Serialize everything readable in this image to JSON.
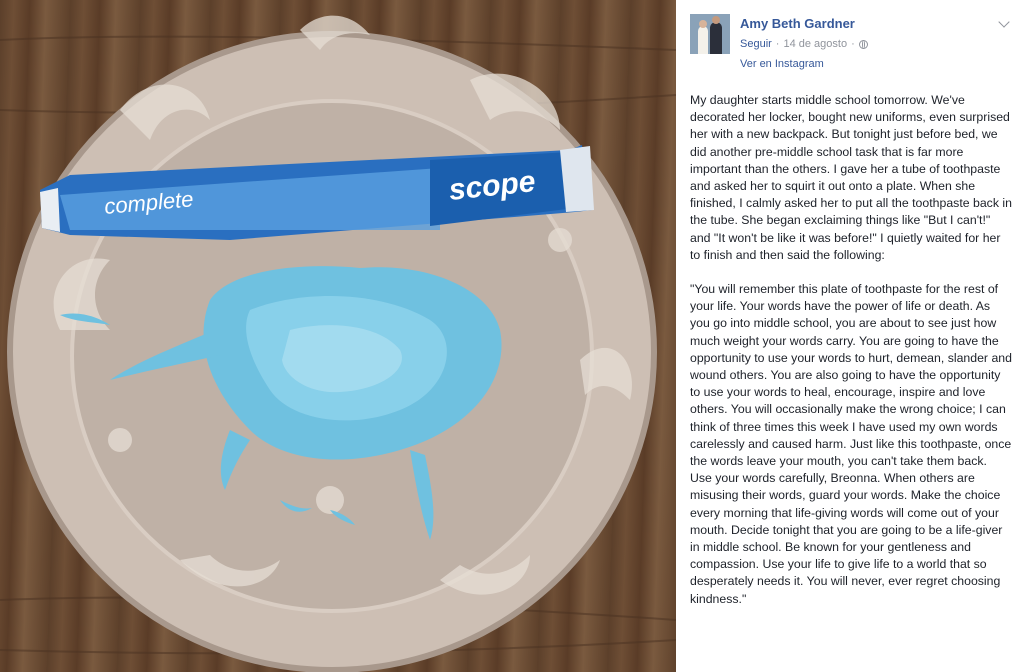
{
  "post": {
    "author": "Amy Beth Gardner",
    "follow_label": "Seguir",
    "separator": "·",
    "date": "14 de agosto",
    "separator2": "·",
    "view_link": "Ver en Instagram",
    "paragraphs": [
      "My daughter starts middle school tomorrow. We've decorated her locker, bought new uniforms, even surprised her with a new backpack. But tonight just before bed, we did another pre-middle school task that is far more important than the others. I gave her a tube of toothpaste and asked her to squirt it out onto a plate. When she finished, I calmly asked her to put all the toothpaste back in the tube. She began exclaiming things like \"But I can't!\" and \"It won't be like it was before!\" I quietly waited for her to finish and then said the following:",
      "\"You will remember this plate of toothpaste for the rest of your life. Your words have the power of life or death. As you go into middle school, you are about to see just how much weight your words carry. You are going to have the opportunity to use your words to hurt, demean, slander and wound others. You are also going to have the opportunity to use your words to heal, encourage, inspire and love others. You will occasionally make the wrong choice; I can think of three times this week I have used my own words carelessly and caused harm. Just like this toothpaste, once the words leave your mouth, you can't take them back. Use your words carefully, Breonna. When others are misusing their words, guard your words. Make the choice every morning that life-giving words will come out of your mouth. Decide tonight that you are going to be a life-giver in middle school. Be known for your gentleness and compassion. Use your life to give life to a world that so desperately needs it. You will never, ever regret choosing kindness.\""
    ]
  },
  "photo": {
    "tube_label_left": "complete",
    "tube_label_right": "scope"
  },
  "colors": {
    "link": "#365899",
    "text": "#1d2129",
    "meta": "#90949c",
    "toothpaste": "#6fc1e0",
    "plate": "#b8aca2"
  }
}
